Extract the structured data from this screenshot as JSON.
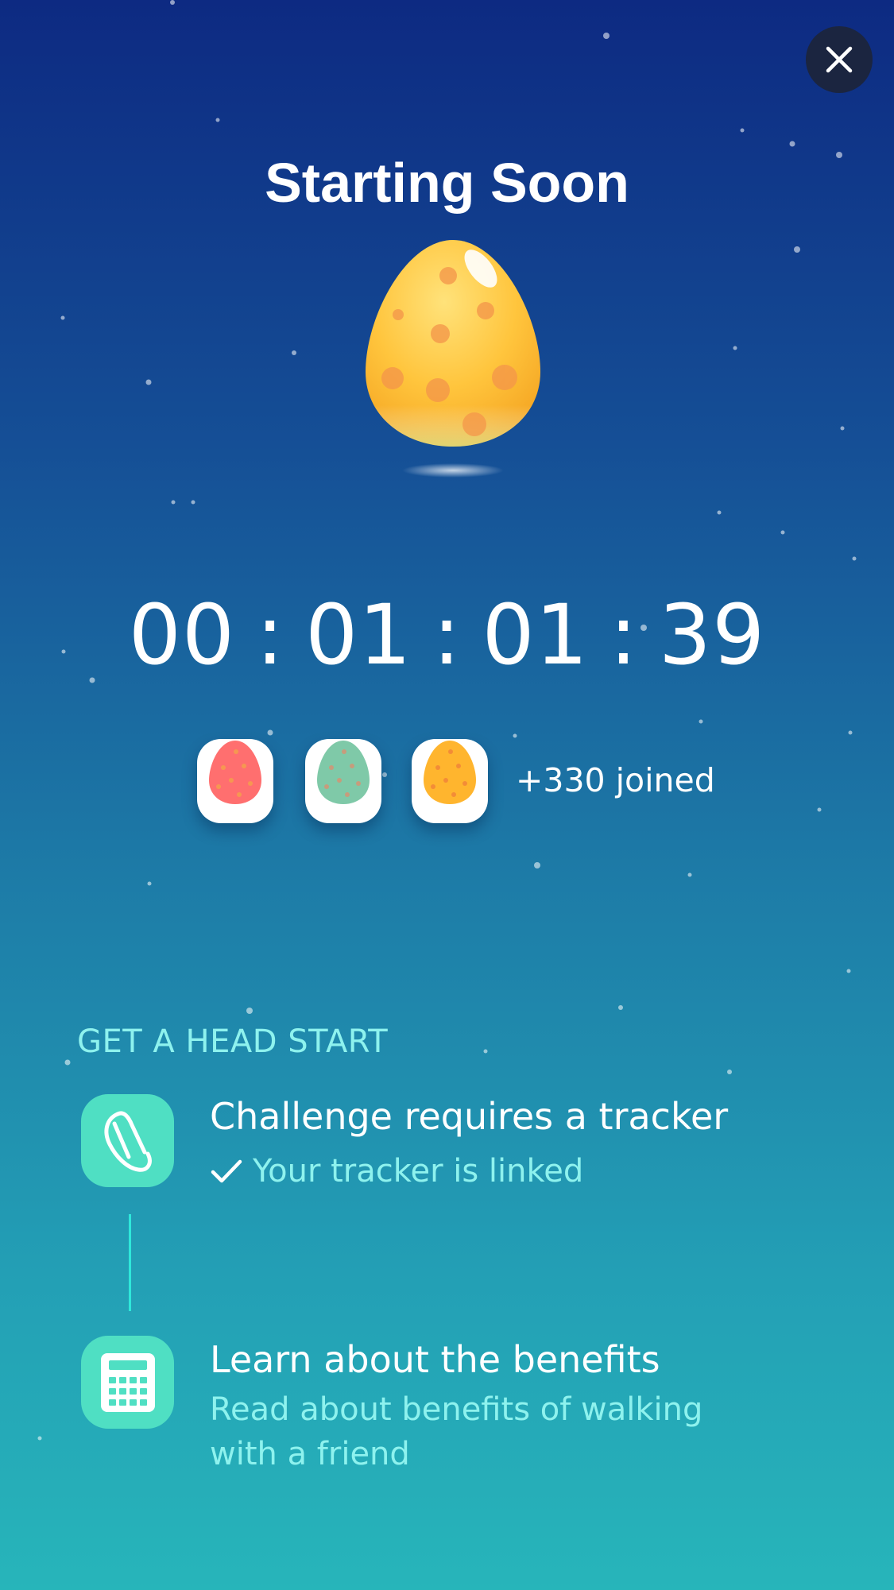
{
  "header": {
    "title": "Starting Soon",
    "close_icon": "close-icon"
  },
  "countdown": {
    "days": "00",
    "hours": "01",
    "minutes": "01",
    "seconds": "39",
    "separator": ":"
  },
  "participants": {
    "avatars": [
      {
        "name": "red-egg-avatar",
        "color": "#ff6f6f"
      },
      {
        "name": "green-egg-avatar",
        "color": "#7fc9a8"
      },
      {
        "name": "yellow-egg-avatar",
        "color": "#ffb52e"
      }
    ],
    "joined_label": "+330 joined"
  },
  "head_start": {
    "section_label": "GET A HEAD START",
    "steps": [
      {
        "icon": "tracker-band-icon",
        "title": "Challenge requires a tracker",
        "subtitle": "Your tracker is linked",
        "status_icon": "checkmark-icon"
      },
      {
        "icon": "calculator-icon",
        "title": "Learn about the benefits",
        "subtitle": "Read about benefits of walking with a friend"
      }
    ]
  },
  "colors": {
    "accent": "#4fdfc3",
    "accent_text": "#8ef2ee",
    "close_button_bg": "#1b2540",
    "egg_yellow": "#ffb52e"
  }
}
